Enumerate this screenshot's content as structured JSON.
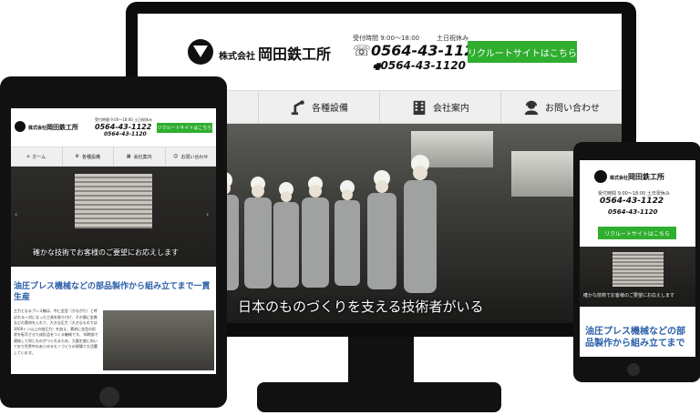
{
  "company": {
    "name_prefix": "株式会社",
    "name": "岡田鉄工所"
  },
  "contact": {
    "hours_label": "受付時間 9:00～18:00",
    "closed_label": "土日祝休み",
    "tel": "0564-43-1122",
    "fax": "0564-43-1120"
  },
  "recruit_button": "リクルートサイトはこちら",
  "nav": [
    {
      "label": "ホーム",
      "icon": "home-icon"
    },
    {
      "label": "各種設備",
      "icon": "robot-arm-icon"
    },
    {
      "label": "会社案内",
      "icon": "building-icon"
    },
    {
      "label": "お問い合わせ",
      "icon": "operator-icon"
    }
  ],
  "desktop_hero_text": "日本のものづくりを支える技術者がいる",
  "tablet_hero_text": "確かな技術でお客様のご要望にお応えします",
  "phone_hero_text": "確かな技術でお客様のご要望にお応えします",
  "tablet_heading": "油圧プレス機械などの部品製作から組み立てまで一貫生産",
  "tablet_paragraph": "主力となるプレス機は、中に金型（かながた）と呼ばれる一対になった工具を取り付け、その間に金属などの素材を入れて、大きな圧力（大きなものでは3000トン以上の加圧力）を加え、素材に金型の形状を転写させた成形品をつくる機械です。 知時部で連結して同じものがつくれるため、大量生産に向いており世界中のあらゆるモノづくりの現場で大活躍しています。",
  "phone_heading": "油圧プレス機械などの部品製作から組み立てまで",
  "colors": {
    "accent_green": "#2fae2f",
    "heading_blue": "#2a5fa8",
    "nav_bg": "#efefef"
  }
}
